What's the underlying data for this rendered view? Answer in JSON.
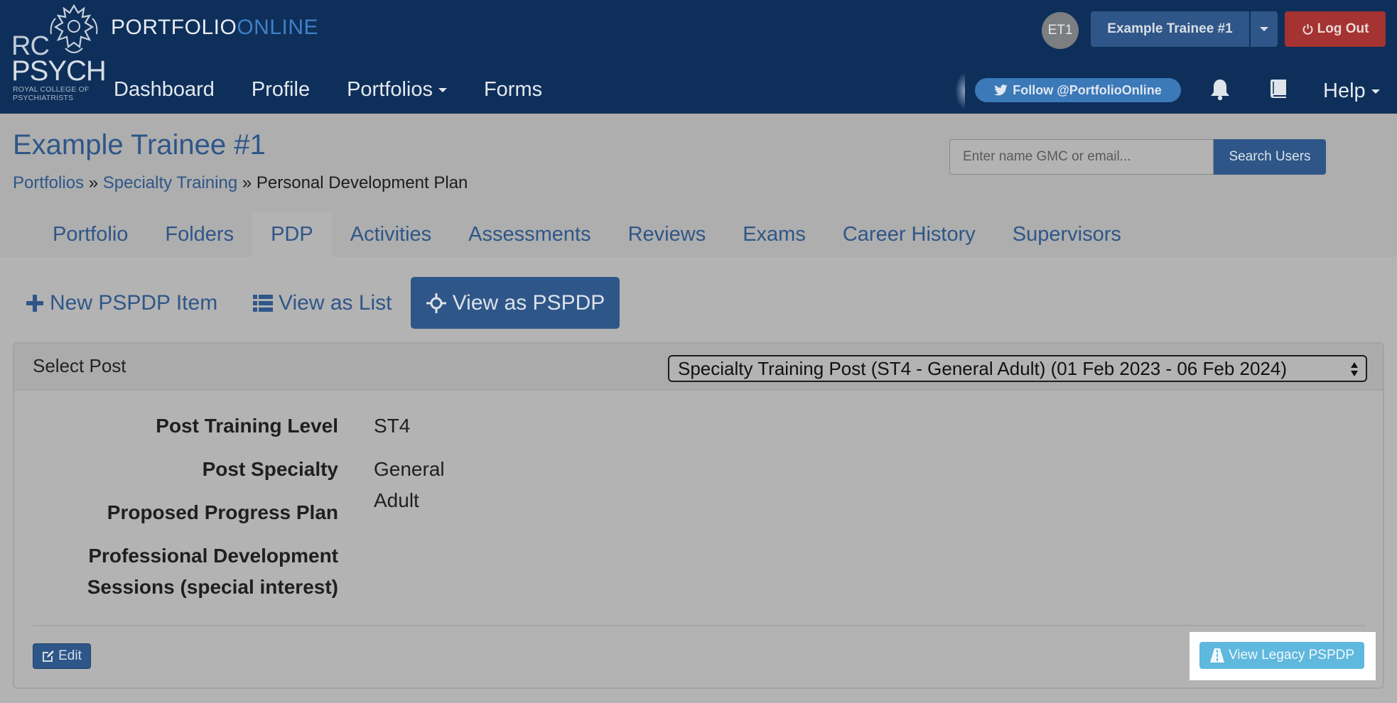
{
  "brand": {
    "logo_rc": "RC",
    "logo_psych": "PSYCH",
    "logo_sub_line1": "ROYAL COLLEGE OF",
    "logo_sub_line2": "PSYCHIATRISTS",
    "name_part1": "PORTFOLIO",
    "name_part2": "ONLINE"
  },
  "nav": {
    "links": [
      "Dashboard",
      "Profile",
      "Portfolios",
      "Forms"
    ],
    "help": "Help"
  },
  "user": {
    "initials": "ET1",
    "name": "Example Trainee #1",
    "logout": "Log Out"
  },
  "twitter": {
    "label": "Follow @PortfolioOnline"
  },
  "page": {
    "title": "Example Trainee #1",
    "breadcrumb": {
      "item1": "Portfolios",
      "sep": "»",
      "item2": "Specialty Training",
      "current": "Personal Development Plan"
    }
  },
  "search": {
    "placeholder": "Enter name GMC or email...",
    "button": "Search Users"
  },
  "tabs": [
    "Portfolio",
    "Folders",
    "PDP",
    "Activities",
    "Assessments",
    "Reviews",
    "Exams",
    "Career History",
    "Supervisors"
  ],
  "active_tab": "PDP",
  "actions": {
    "new_item": "New PSPDP Item",
    "view_list": "View as List",
    "view_pspdp": "View as PSPDP"
  },
  "panel": {
    "select_label": "Select Post",
    "selected_post": "Specialty Training Post (ST4 - General Adult) (01 Feb 2023 - 06 Feb 2024)",
    "fields": {
      "training_level": {
        "label": "Post Training Level",
        "value": "ST4"
      },
      "specialty": {
        "label": "Post Specialty",
        "value": "General Adult"
      },
      "progress_plan": {
        "label": "Proposed Progress Plan",
        "value": ""
      },
      "pd_sessions": {
        "label_line1": "Professional Development",
        "label_line2": "Sessions (special interest)",
        "value": ""
      }
    },
    "edit": "Edit",
    "legacy": "View Legacy PSPDP"
  },
  "colors": {
    "navbar": "#0e2f5a",
    "primary": "#2f5688",
    "danger": "#a43331",
    "info": "#5fb8de",
    "twitter": "#3b79b8"
  }
}
